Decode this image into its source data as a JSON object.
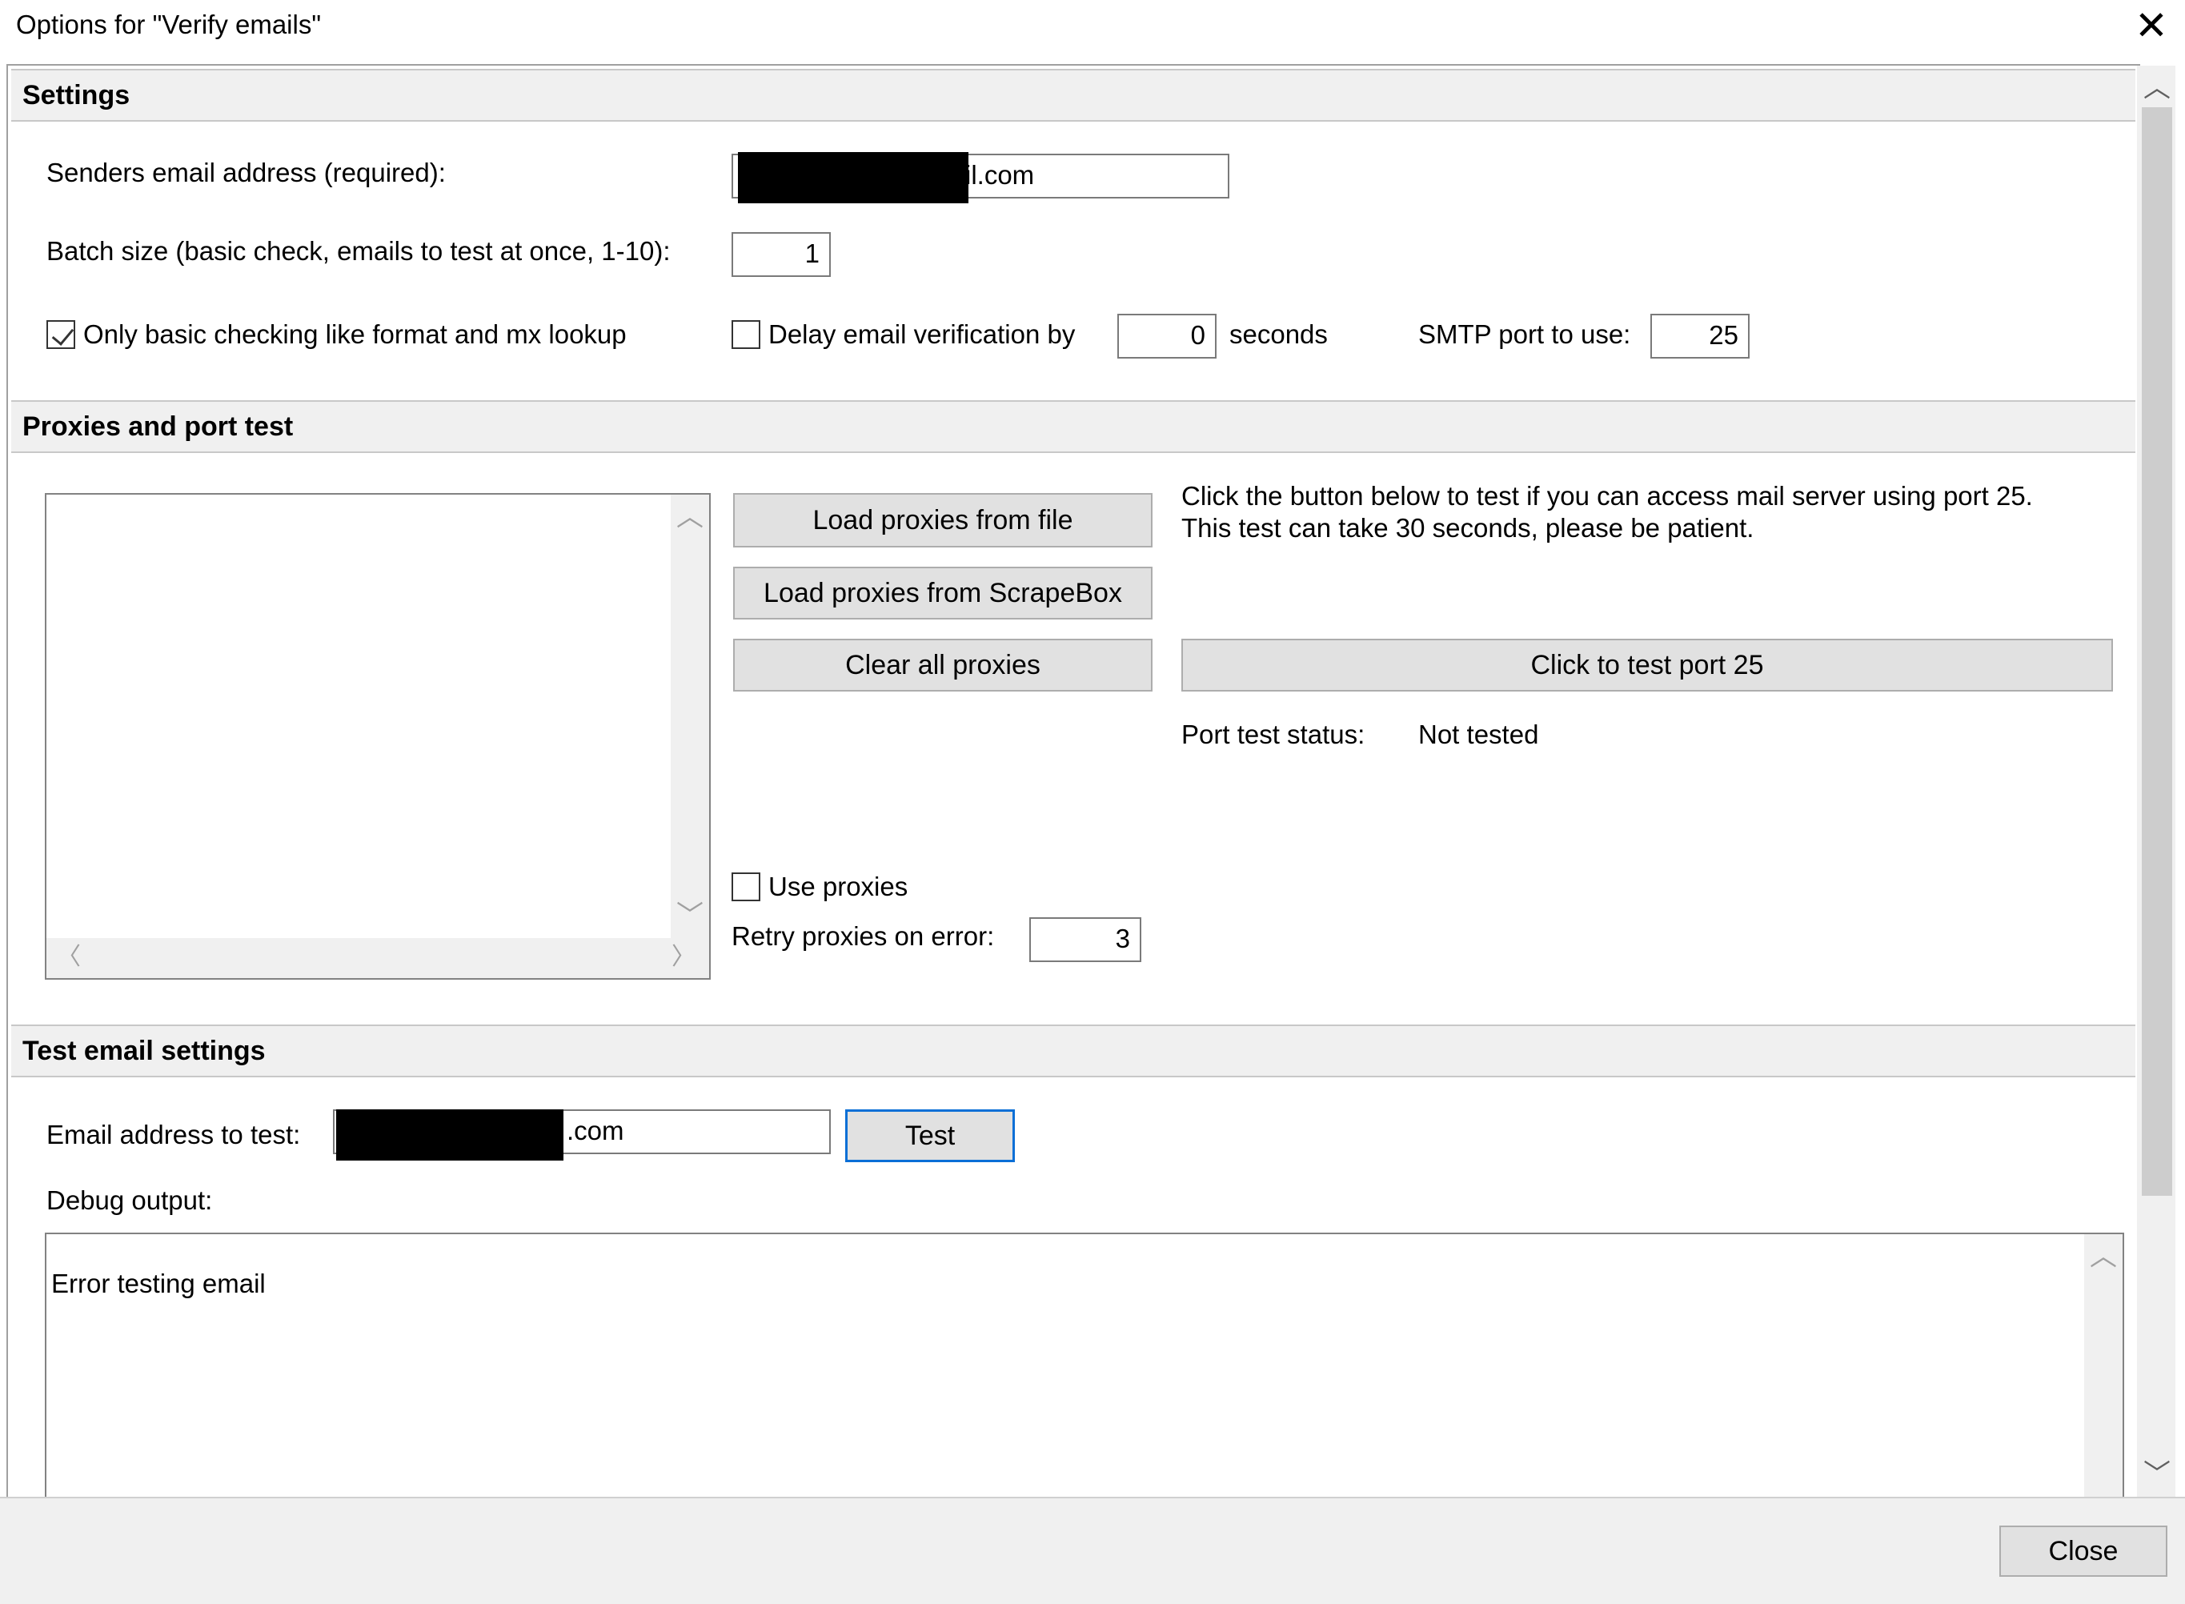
{
  "window": {
    "title": "Options for \"Verify emails\"",
    "close_glyph": "✕"
  },
  "settings": {
    "header": "Settings",
    "sender_label": "Senders email address (required):",
    "sender_value_visible": "il.com",
    "batch_label": "Batch size (basic check,  emails to test at once, 1-10):",
    "batch_value": "1",
    "basic_check_label": "Only basic checking like format and mx lookup",
    "basic_check_checked": true,
    "delay_label": "Delay email verification by",
    "delay_checked": false,
    "delay_value": "0",
    "delay_unit": "seconds",
    "smtp_label": "SMTP port to use:",
    "smtp_value": "25"
  },
  "proxies": {
    "header": "Proxies and port test",
    "load_file_button": "Load proxies from file",
    "load_scrapebox_button": "Load proxies from ScrapeBox",
    "clear_button": "Clear all proxies",
    "info_line1": "Click the button below to test if you can access mail server using port 25.",
    "info_line2": "This test can take 30 seconds, please be patient.",
    "test_port_button": "Click to test port 25",
    "status_label": "Port test status:",
    "status_value": "Not tested",
    "use_proxies_label": "Use proxies",
    "use_proxies_checked": false,
    "retry_label": "Retry proxies on error:",
    "retry_value": "3"
  },
  "test_email": {
    "header": "Test email settings",
    "address_label": "Email address to test:",
    "address_value_visible": ".com",
    "test_button": "Test",
    "debug_label": "Debug output:",
    "debug_output": "Error testing email"
  },
  "footer": {
    "close_button": "Close"
  },
  "icons": {
    "up": "︿",
    "down": "﹀",
    "left": "〈",
    "right": "〉"
  }
}
